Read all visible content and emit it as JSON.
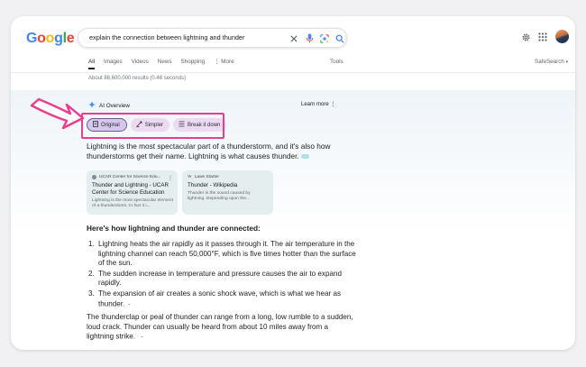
{
  "header": {
    "logo": {
      "text": "Google",
      "letters": [
        {
          "ch": "G",
          "color": "#4285f4"
        },
        {
          "ch": "o",
          "color": "#ea4335"
        },
        {
          "ch": "o",
          "color": "#fbbc05"
        },
        {
          "ch": "g",
          "color": "#4285f4"
        },
        {
          "ch": "l",
          "color": "#34a853"
        },
        {
          "ch": "e",
          "color": "#ea4335"
        }
      ]
    },
    "search": {
      "query": "explain the connection between lightning and thunder"
    },
    "icons": [
      "clear-icon",
      "mic-icon",
      "lens-icon",
      "search-icon",
      "settings-icon",
      "apps-icon",
      "avatar"
    ]
  },
  "tabs": {
    "items": [
      "All",
      "Images",
      "Videos",
      "News",
      "Shopping",
      "More"
    ],
    "active": "All",
    "tools": "Tools",
    "safesearch": "SafeSearch"
  },
  "results_count": "About 88,600,000 results (0.46 seconds)",
  "ai_overview": {
    "label": "AI Overview",
    "learn_more": "Learn more",
    "chips": [
      "Original",
      "Simpler",
      "Break it down"
    ],
    "active_chip": "Original",
    "highlight_color": "#ec3c8b",
    "lead": "Lightning is the most spectacular part of a thunderstorm, and it's also how thunderstorms get their name. Lightning is what causes thunder.",
    "sources": [
      {
        "site": "UCAR Center for Science Edu...",
        "title": "Thunder and Lightning - UCAR Center for Science Education",
        "snippet": "Lightning is the most spectacular element of a thunderstorm. In fact it i..."
      },
      {
        "site": "Lawn Starter",
        "title": "Thunder - Wikipedia",
        "snippet": "Thunder is the sound caused by lightning. Depending upon the..."
      }
    ],
    "heading": "Here's how lightning and thunder are connected:",
    "steps": [
      "Lightning heats the air rapidly as it passes through it. The air temperature in the lightning channel can reach 50,000°F, which is five times hotter than the surface of the sun.",
      "The sudden increase in temperature and pressure causes the air to expand rapidly.",
      "The expansion of air creates a sonic shock wave, which is what we hear as thunder."
    ],
    "closing": "The thunderclap or peal of thunder can range from a long, low rumble to a sudden, loud crack. Thunder can usually be heard from about 10 miles away from a lightning strike."
  }
}
